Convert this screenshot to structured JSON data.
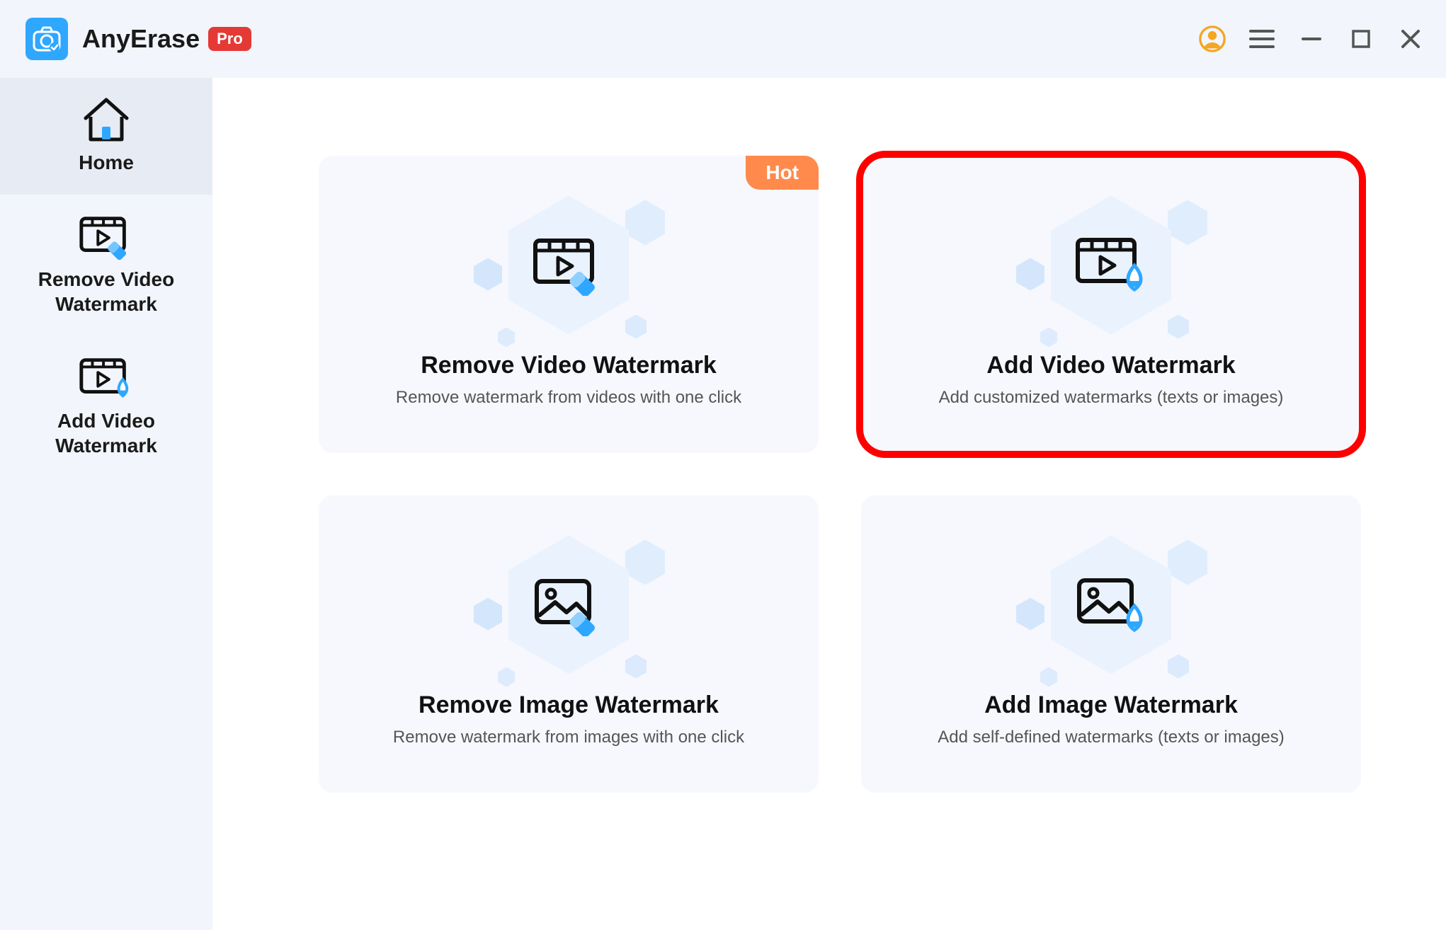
{
  "app": {
    "title": "AnyErase",
    "badge": "Pro"
  },
  "sidebar": {
    "items": [
      {
        "label": "Home",
        "icon": "home-icon"
      },
      {
        "label": "Remove Video\nWatermark",
        "icon": "video-erase-icon"
      },
      {
        "label": "Add Video\nWatermark",
        "icon": "video-drop-icon"
      }
    ]
  },
  "cards": {
    "remove_video": {
      "title": "Remove Video Watermark",
      "subtitle": "Remove watermark from videos with one click",
      "hot": "Hot"
    },
    "add_video": {
      "title": "Add Video Watermark",
      "subtitle": "Add customized watermarks (texts or images)"
    },
    "remove_image": {
      "title": "Remove Image Watermark",
      "subtitle": "Remove watermark from images with one click"
    },
    "add_image": {
      "title": "Add Image Watermark",
      "subtitle": "Add self-defined watermarks  (texts or images)"
    }
  }
}
